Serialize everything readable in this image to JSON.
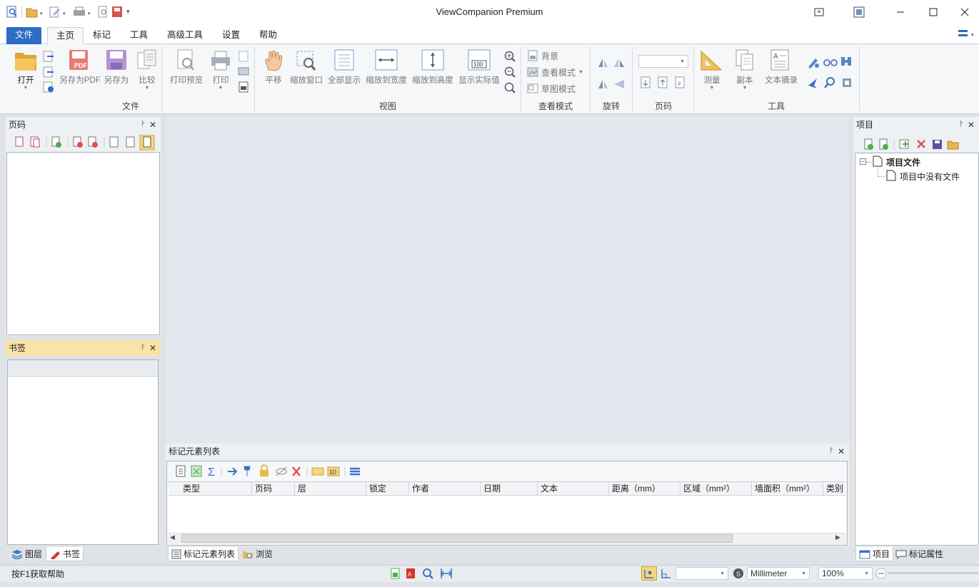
{
  "window": {
    "title": "ViewCompanion Premium",
    "controls": [
      "minimize",
      "maximize",
      "close"
    ]
  },
  "ribbon_tabs": [
    "文件",
    "主页",
    "标记",
    "工具",
    "高级工具",
    "设置",
    "帮助"
  ],
  "ribbon": {
    "file_group": {
      "label": "文件",
      "open": "打开",
      "save_pdf": "另存为PDF",
      "save_as": "另存为",
      "compare": "比较"
    },
    "view_group": {
      "label": "视图",
      "print_preview": "打印预览",
      "print": "打印",
      "pan": "平移",
      "zoom_window": "缩放窗口",
      "fit_all": "全部显示",
      "fit_width": "缩放到宽度",
      "fit_height": "缩放到高度",
      "actual_size": "显示实际值"
    },
    "view_mode_group": {
      "label": "查看模式",
      "background": "背景",
      "view_mode": "查看模式",
      "draft_mode": "草图模式"
    },
    "rotate_group": {
      "label": "旋转"
    },
    "page_group": {
      "label": "页码"
    },
    "tools_group": {
      "label": "工具",
      "measure": "测量",
      "copy": "副本",
      "text_extract": "文本摘录"
    },
    "page_icon_badge": "100"
  },
  "panels": {
    "pages": {
      "title": "页码"
    },
    "bookmarks": {
      "title": "书签"
    },
    "markup_list": {
      "title": "标记元素列表",
      "badge": "10",
      "columns": [
        "类型",
        "页码",
        "层",
        "锁定",
        "作者",
        "日期",
        "文本",
        "距离（mm）",
        "区域（mm²）",
        "墙面积（mm²）",
        "类别"
      ]
    },
    "project": {
      "title": "项目",
      "root": "项目文件",
      "child": "项目中没有文件"
    }
  },
  "bottom_tabs": {
    "left": [
      "图层",
      "书签"
    ],
    "center": [
      "标记元素列表",
      "浏览"
    ],
    "right": [
      "项目",
      "标记属性"
    ]
  },
  "status": {
    "help": "按F1获取帮助",
    "unit": "Millimeter",
    "zoom": "100%"
  },
  "colors": {
    "accent": "#2b6cc4",
    "panel_header_active": "#f9e3a6",
    "document_area": "#e4e8ee"
  }
}
